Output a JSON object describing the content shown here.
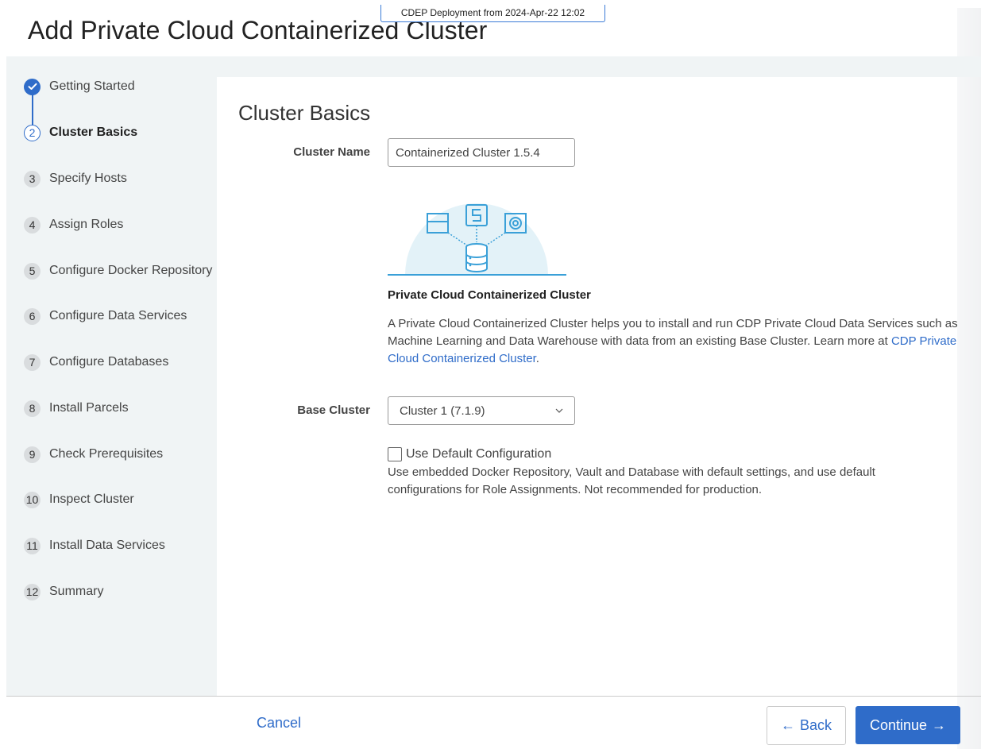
{
  "header": {
    "title": "Add Private Cloud Containerized Cluster",
    "deployment_badge": "CDEP Deployment from 2024-Apr-22 12:02"
  },
  "steps": [
    {
      "number": "1",
      "label": "Getting Started",
      "state": "done"
    },
    {
      "number": "2",
      "label": "Cluster Basics",
      "state": "active"
    },
    {
      "number": "3",
      "label": "Specify Hosts",
      "state": "pending"
    },
    {
      "number": "4",
      "label": "Assign Roles",
      "state": "pending"
    },
    {
      "number": "5",
      "label": "Configure Docker Repository",
      "state": "pending"
    },
    {
      "number": "6",
      "label": "Configure Data Services",
      "state": "pending"
    },
    {
      "number": "7",
      "label": "Configure Databases",
      "state": "pending"
    },
    {
      "number": "8",
      "label": "Install Parcels",
      "state": "pending"
    },
    {
      "number": "9",
      "label": "Check Prerequisites",
      "state": "pending"
    },
    {
      "number": "10",
      "label": "Inspect Cluster",
      "state": "pending"
    },
    {
      "number": "11",
      "label": "Install Data Services",
      "state": "pending"
    },
    {
      "number": "12",
      "label": "Summary",
      "state": "pending"
    }
  ],
  "main": {
    "section_title": "Cluster Basics",
    "cluster_name_label": "Cluster Name",
    "cluster_name_value": "Containerized Cluster 1.5.4",
    "description_title": "Private Cloud Containerized Cluster",
    "description_text": "A Private Cloud Containerized Cluster helps you to install and run CDP Private Cloud Data Services such as Machine Learning and Data Warehouse with data from an existing Base Cluster. Learn more at ",
    "description_link": "CDP Private Cloud Containerized Cluster",
    "description_end": ".",
    "base_cluster_label": "Base Cluster",
    "base_cluster_value": "Cluster 1 (7.1.9)",
    "default_config_label": "Use Default Configuration",
    "default_config_checked": false,
    "default_config_help": "Use embedded Docker Repository, Vault and Database with default settings, and use default configurations for Role Assignments. Not recommended for production."
  },
  "footer": {
    "cancel_label": "Cancel",
    "back_label": "Back",
    "continue_label": "Continue"
  },
  "colors": {
    "accent": "#2f6cc9",
    "sidebar_bg": "#f0f4f5",
    "illustration_circle": "#e3f2f8",
    "illustration_stroke": "#3aa0d8"
  }
}
